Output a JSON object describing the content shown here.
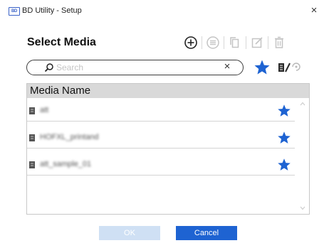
{
  "window": {
    "icon_text": "BD",
    "title": "BD Utility - Setup",
    "close_glyph": "×"
  },
  "heading": "Select Media",
  "toolbar": {
    "icons": [
      "add-circle-icon",
      "list-circle-icon",
      "copy-icon",
      "edit-icon",
      "delete-icon"
    ]
  },
  "search": {
    "placeholder": "Search",
    "value": "",
    "clear_glyph": "×"
  },
  "table": {
    "header": "Media Name",
    "rows": [
      {
        "name": "att",
        "favorite": true
      },
      {
        "name": "HOFXL_printand",
        "favorite": true
      },
      {
        "name": "att_sample_01",
        "favorite": true
      }
    ]
  },
  "buttons": {
    "ok": "OK",
    "cancel": "Cancel"
  },
  "colors": {
    "accent": "#1e63d2",
    "star": "#1e63d2",
    "disabled_button": "#cfe0f4",
    "header_bg": "#d9d9d9"
  }
}
